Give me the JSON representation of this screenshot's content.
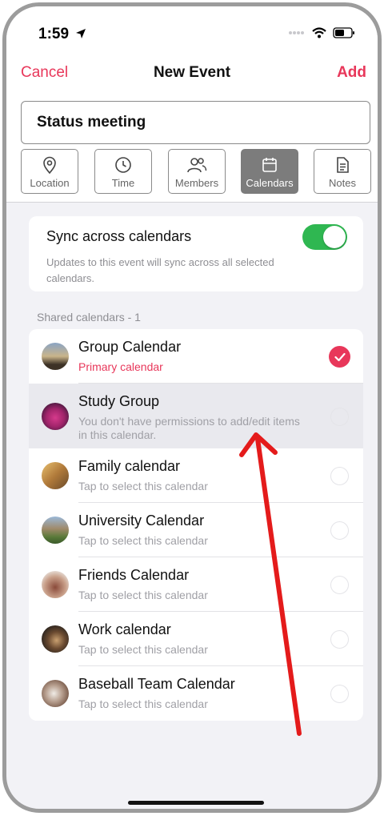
{
  "status_bar": {
    "time": "1:59"
  },
  "nav": {
    "cancel": "Cancel",
    "title": "New Event",
    "add": "Add"
  },
  "event": {
    "title": "Status meeting"
  },
  "tabs": [
    {
      "label": "Location",
      "icon": "location-pin-icon",
      "active": false
    },
    {
      "label": "Time",
      "icon": "clock-icon",
      "active": false
    },
    {
      "label": "Members",
      "icon": "people-icon",
      "active": false
    },
    {
      "label": "Calendars",
      "icon": "calendar-icon",
      "active": true
    },
    {
      "label": "Notes",
      "icon": "document-icon",
      "active": false
    }
  ],
  "sync": {
    "title": "Sync across calendars",
    "description": "Updates to this event will sync across all selected calendars.",
    "enabled": true
  },
  "shared_label": "Shared calendars - 1",
  "calendars": [
    {
      "name": "Group Calendar",
      "subtitle": "Primary calendar",
      "state": "selected"
    },
    {
      "name": "Study Group",
      "subtitle": "You don't have permissions to add/edit items in this calendar.",
      "state": "disabled"
    },
    {
      "name": "Family calendar",
      "subtitle": "Tap to select this calendar",
      "state": "unselected"
    },
    {
      "name": "University Calendar",
      "subtitle": "Tap to select this calendar",
      "state": "unselected"
    },
    {
      "name": "Friends Calendar",
      "subtitle": "Tap to select this calendar",
      "state": "unselected"
    },
    {
      "name": "Work calendar",
      "subtitle": "Tap to select this calendar",
      "state": "unselected"
    },
    {
      "name": "Baseball Team Calendar",
      "subtitle": "Tap to select this calendar",
      "state": "unselected"
    }
  ],
  "colors": {
    "accent": "#e8375a",
    "toggle_on": "#2fb751",
    "annotation_arrow": "#e41b1b"
  }
}
